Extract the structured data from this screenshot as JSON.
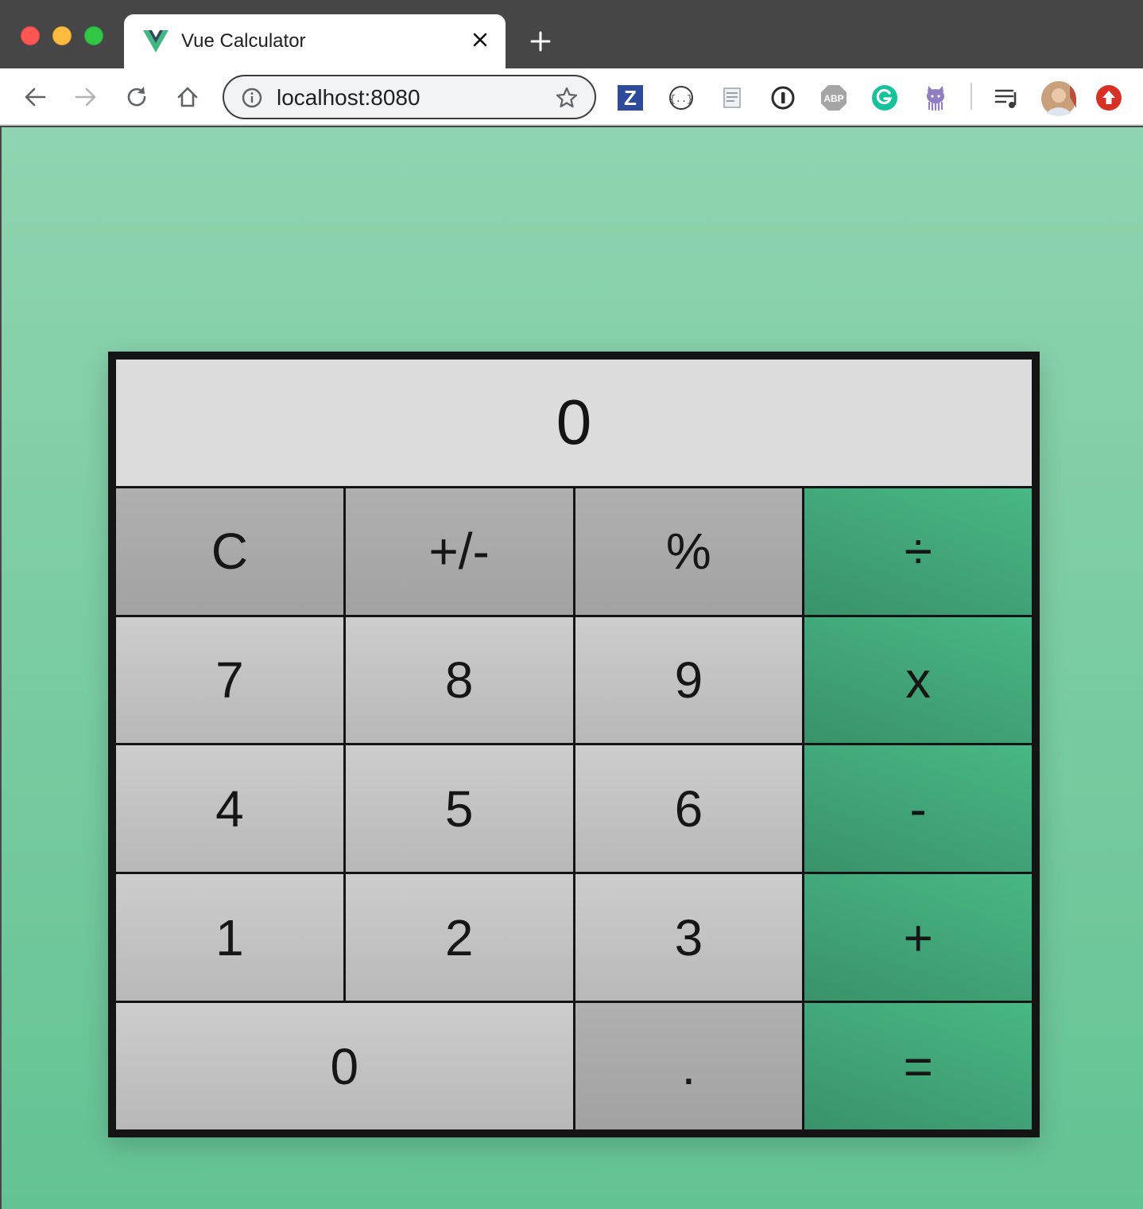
{
  "tab": {
    "title": "Vue Calculator"
  },
  "omnibox": {
    "url": "localhost:8080"
  },
  "extensions": [
    "zotero-icon",
    "json-viewer-icon",
    "notes-icon",
    "onepassword-icon",
    "adblock-plus-icon",
    "grammarly-icon",
    "octocat-icon",
    "media-control-icon",
    "profile-avatar",
    "update-icon"
  ],
  "extension_labels": {
    "zotero": "Z",
    "adblock": "ABP"
  },
  "calculator": {
    "display": "0",
    "keys": {
      "clear": "C",
      "sign": "+/-",
      "percent": "%",
      "divide": "÷",
      "seven": "7",
      "eight": "8",
      "nine": "9",
      "multiply": "x",
      "four": "4",
      "five": "5",
      "six": "6",
      "subtract": "-",
      "one": "1",
      "two": "2",
      "three": "3",
      "add": "+",
      "zero": "0",
      "decimal": ".",
      "equals": "="
    }
  },
  "colors": {
    "page_top": "#8fd4b0",
    "page_bottom": "#64c393",
    "operator": "#48b884",
    "function_key": "#a9a9a9",
    "number_key": "#c4c4c4",
    "display_bg": "#dcdcdc",
    "frame": "#141414"
  }
}
